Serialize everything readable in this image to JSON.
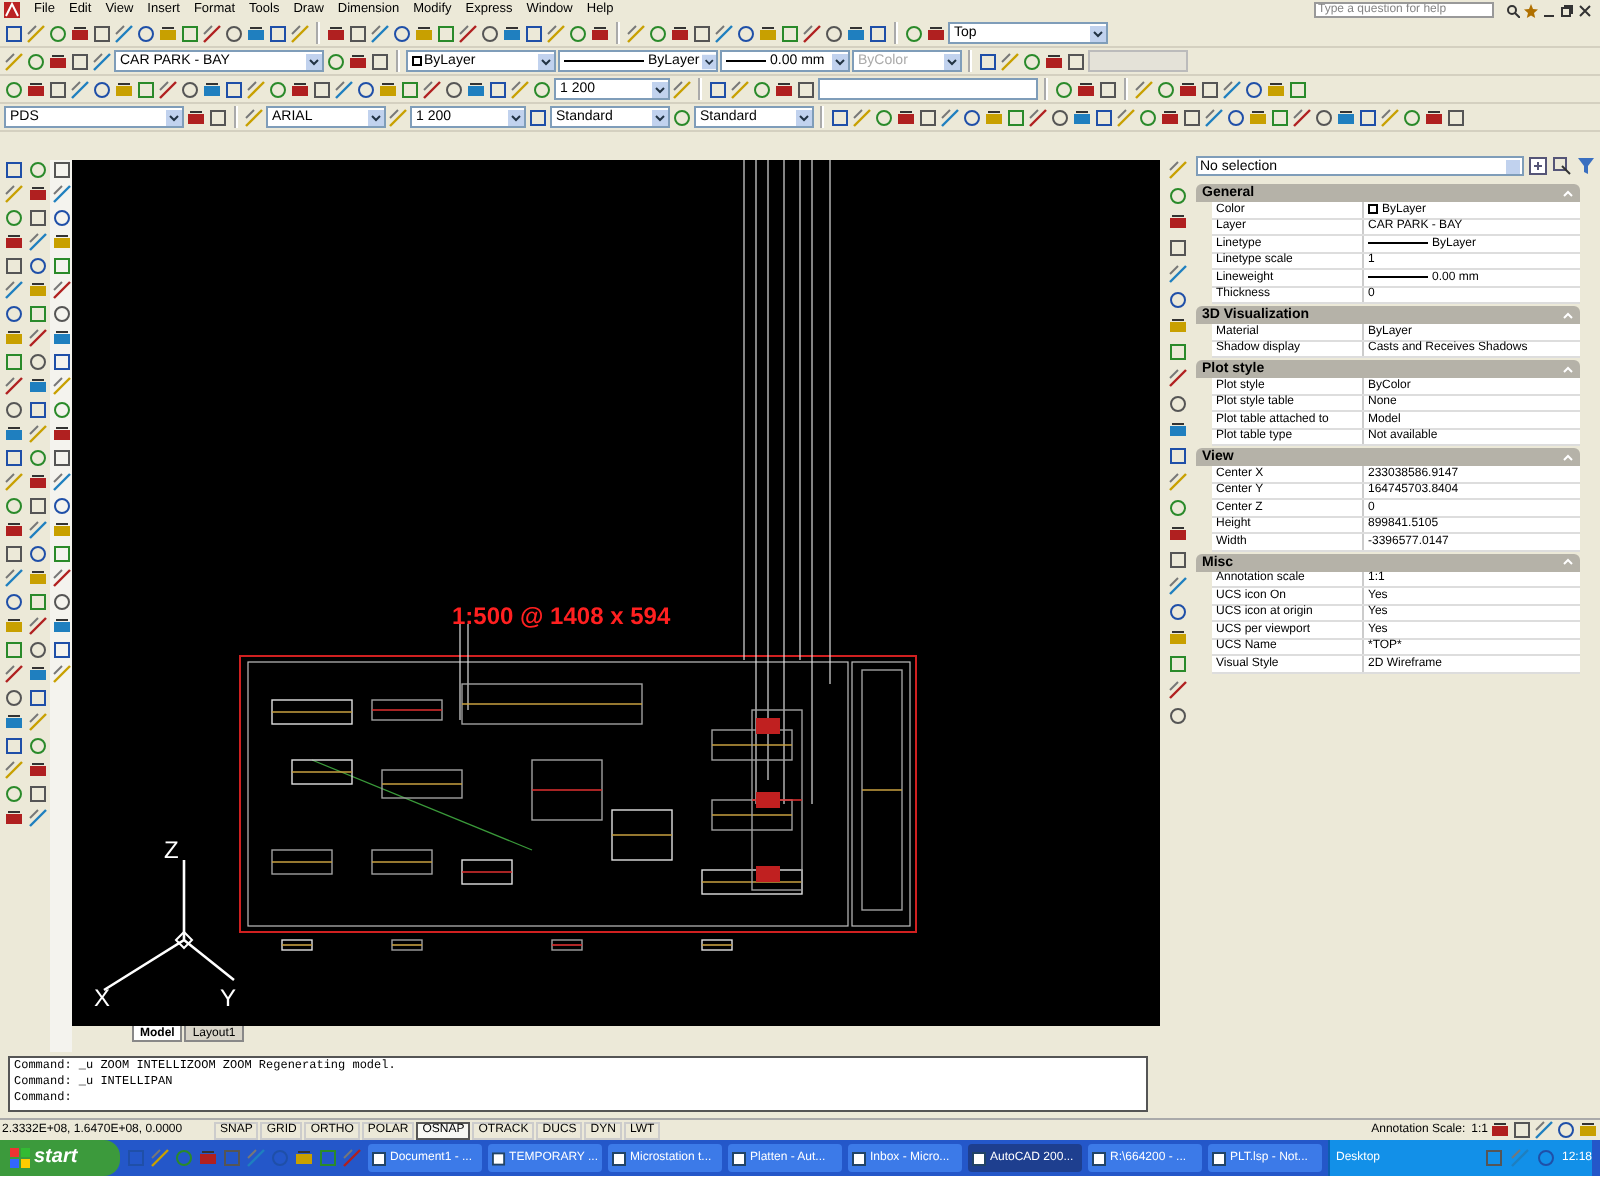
{
  "menu_bar": [
    "File",
    "Edit",
    "View",
    "Insert",
    "Format",
    "Tools",
    "Draw",
    "Dimension",
    "Modify",
    "Express",
    "Window",
    "Help"
  ],
  "help_search": {
    "placeholder": "Type a question for help"
  },
  "toolbars": {
    "layer": "CAR PARK - BAY",
    "color_setting": "ByLayer",
    "linetype": "ByLayer",
    "lineweight": "0.00 mm",
    "plot_style": "ByColor",
    "view": "Top",
    "dimension_scale": "1 200",
    "style_name": "PDS",
    "font": "ARIAL",
    "text_height": "1 200",
    "text_style": "Standard",
    "table_style": "Standard"
  },
  "drawing": {
    "scale_label": "1:500 @ 1408 x 594",
    "ucs_labels": [
      "Z",
      "X",
      "Y"
    ]
  },
  "layout_tabs": [
    {
      "label": "Model",
      "selected": true
    },
    {
      "label": "Layout1",
      "selected": false
    }
  ],
  "properties": {
    "selection": "No selection",
    "sections": [
      {
        "title": "General",
        "rows": [
          {
            "label": "Color",
            "value": "ByLayer",
            "kind": "swatch"
          },
          {
            "label": "Layer",
            "value": "CAR PARK - BAY",
            "kind": "text"
          },
          {
            "label": "Linetype",
            "value": "ByLayer",
            "kind": "line"
          },
          {
            "label": "Linetype scale",
            "value": "1",
            "kind": "text"
          },
          {
            "label": "Lineweight",
            "value": "0.00 mm",
            "kind": "line"
          },
          {
            "label": "Thickness",
            "value": "0",
            "kind": "text"
          }
        ]
      },
      {
        "title": "3D Visualization",
        "rows": [
          {
            "label": "Material",
            "value": "ByLayer",
            "kind": "text"
          },
          {
            "label": "Shadow display",
            "value": "Casts and Receives Shadows",
            "kind": "text"
          }
        ]
      },
      {
        "title": "Plot style",
        "rows": [
          {
            "label": "Plot style",
            "value": "ByColor",
            "kind": "text"
          },
          {
            "label": "Plot style table",
            "value": "None",
            "kind": "text"
          },
          {
            "label": "Plot table attached to",
            "value": "Model",
            "kind": "text"
          },
          {
            "label": "Plot table type",
            "value": "Not available",
            "kind": "text"
          }
        ]
      },
      {
        "title": "View",
        "rows": [
          {
            "label": "Center X",
            "value": "233038586.9147",
            "kind": "text"
          },
          {
            "label": "Center Y",
            "value": "164745703.8404",
            "kind": "text"
          },
          {
            "label": "Center Z",
            "value": "0",
            "kind": "text"
          },
          {
            "label": "Height",
            "value": "899841.5105",
            "kind": "text"
          },
          {
            "label": "Width",
            "value": "-3396577.0147",
            "kind": "text"
          }
        ]
      },
      {
        "title": "Misc",
        "rows": [
          {
            "label": "Annotation scale",
            "value": "1:1",
            "kind": "text"
          },
          {
            "label": "UCS icon On",
            "value": "Yes",
            "kind": "text"
          },
          {
            "label": "UCS icon at origin",
            "value": "Yes",
            "kind": "text"
          },
          {
            "label": "UCS per viewport",
            "value": "Yes",
            "kind": "text"
          },
          {
            "label": "UCS Name",
            "value": "*TOP*",
            "kind": "text"
          },
          {
            "label": "Visual Style",
            "value": "2D Wireframe",
            "kind": "text"
          }
        ]
      }
    ]
  },
  "command_lines": [
    "Command: _u ZOOM INTELLIZOOM ZOOM Regenerating model.",
    "Command: _u INTELLIPAN",
    "Command:"
  ],
  "status_bar": {
    "coordinates": "2.3332E+08, 1.6470E+08, 0.0000",
    "toggles": [
      {
        "label": "SNAP",
        "on": false
      },
      {
        "label": "GRID",
        "on": false
      },
      {
        "label": "ORTHO",
        "on": false
      },
      {
        "label": "POLAR",
        "on": false
      },
      {
        "label": "OSNAP",
        "on": true
      },
      {
        "label": "OTRACK",
        "on": false
      },
      {
        "label": "DUCS",
        "on": false
      },
      {
        "label": "DYN",
        "on": false
      },
      {
        "label": "LWT",
        "on": false
      }
    ],
    "annotation_label": "Annotation Scale:",
    "annotation_value": "1:1"
  },
  "taskbar": {
    "start": "start",
    "tasks": [
      {
        "label": "Document1 - ...",
        "selected": false
      },
      {
        "label": "TEMPORARY ...",
        "selected": false
      },
      {
        "label": "Microstation t...",
        "selected": false
      },
      {
        "label": "Platten - Aut...",
        "selected": false
      },
      {
        "label": "Inbox - Micro...",
        "selected": false
      },
      {
        "label": "AutoCAD 200...",
        "selected": true
      },
      {
        "label": "R:\\664200 - ...",
        "selected": false
      },
      {
        "label": "PLT.lsp - Not...",
        "selected": false
      }
    ],
    "desktop": "Desktop",
    "clock": "12:18"
  }
}
